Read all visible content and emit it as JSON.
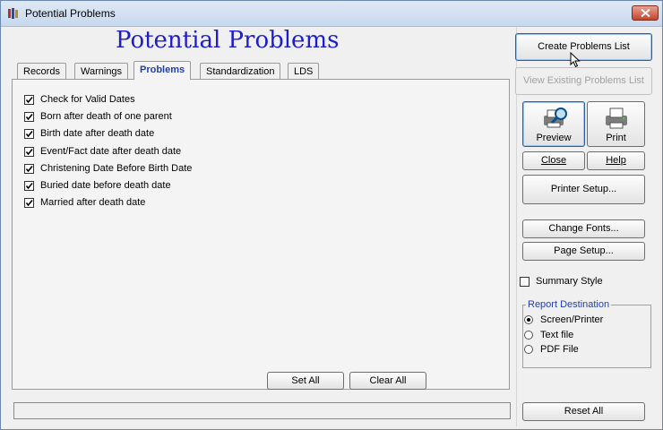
{
  "window": {
    "title": "Potential Problems"
  },
  "heading": "Potential Problems",
  "tabs": [
    {
      "label": "Records",
      "active": false
    },
    {
      "label": "Warnings",
      "active": false
    },
    {
      "label": "Problems",
      "active": true
    },
    {
      "label": "Standardization",
      "active": false
    },
    {
      "label": "LDS",
      "active": false
    }
  ],
  "problems": [
    {
      "label": "Check for Valid Dates",
      "checked": true
    },
    {
      "label": "Born after death of one parent",
      "checked": true
    },
    {
      "label": "Birth date after death date",
      "checked": true
    },
    {
      "label": "Event/Fact date after death date",
      "checked": true
    },
    {
      "label": "Christening Date Before Birth Date",
      "checked": true
    },
    {
      "label": "Buried date before death date",
      "checked": true
    },
    {
      "label": "Married after death date",
      "checked": true
    }
  ],
  "panel_buttons": {
    "set_all": "Set All",
    "clear_all": "Clear All"
  },
  "side": {
    "create_list": "Create Problems List",
    "view_list": "View Existing Problems List",
    "preview": "Preview",
    "print": "Print",
    "close": "Close",
    "help": "Help",
    "printer_setup": "Printer Setup...",
    "change_fonts": "Change Fonts...",
    "page_setup": "Page Setup...",
    "summary_style": "Summary Style",
    "reset_all": "Reset All"
  },
  "report_destination": {
    "legend": "Report Destination",
    "options": [
      {
        "label": "Screen/Printer",
        "selected": true
      },
      {
        "label": "Text file",
        "selected": false
      },
      {
        "label": "PDF File",
        "selected": false
      }
    ]
  },
  "colors": {
    "heading": "#1e1ec8",
    "active_tab": "#1f3fae",
    "close_button": "#c4462f"
  }
}
